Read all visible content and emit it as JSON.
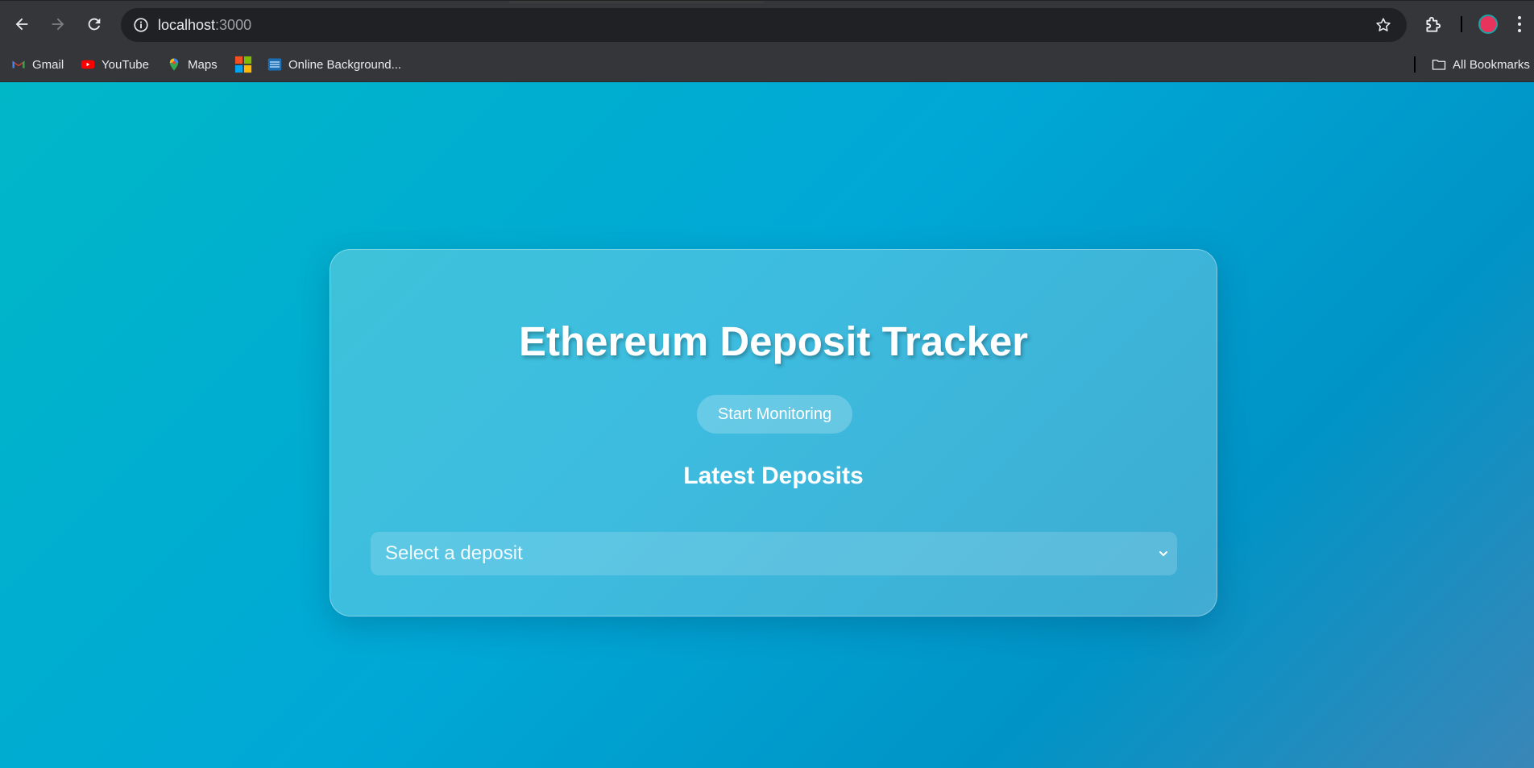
{
  "browser": {
    "url_host": "localhost",
    "url_port": ":3000",
    "bookmarks": [
      {
        "label": "Gmail",
        "icon": "gmail-icon"
      },
      {
        "label": "YouTube",
        "icon": "youtube-icon"
      },
      {
        "label": "Maps",
        "icon": "maps-icon"
      },
      {
        "label": "",
        "icon": "microsoft-icon"
      },
      {
        "label": "Online Background...",
        "icon": "online-background-icon"
      }
    ],
    "all_bookmarks_label": "All Bookmarks"
  },
  "page": {
    "title": "Ethereum Deposit Tracker",
    "start_button_label": "Start Monitoring",
    "latest_heading": "Latest Deposits",
    "select_placeholder": "Select a deposit"
  },
  "colors": {
    "gradient_start": "#00b7c7",
    "gradient_end": "#3a86b8",
    "text": "#ffffff"
  }
}
